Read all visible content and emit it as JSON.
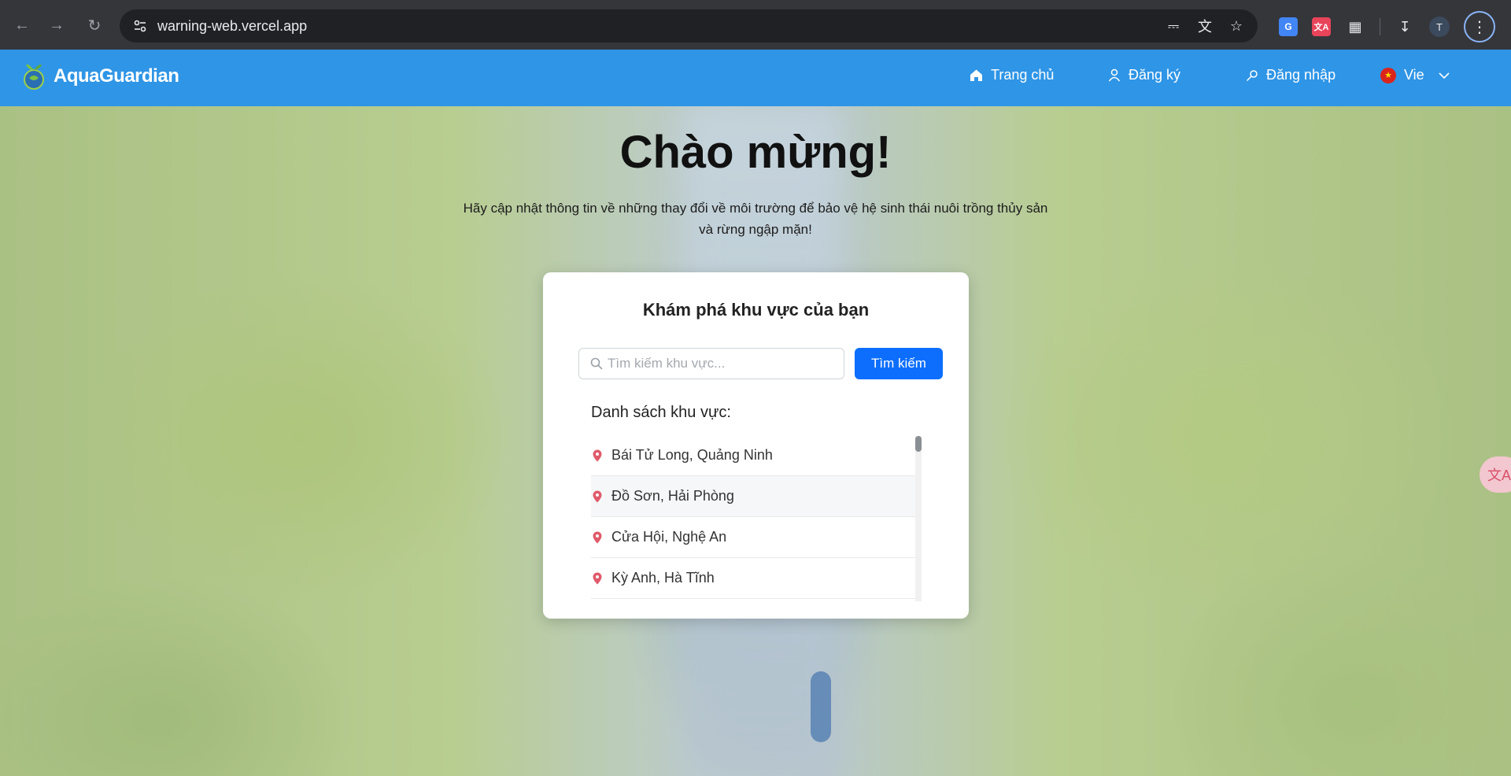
{
  "browser": {
    "url": "warning-web.vercel.app",
    "avatar_letter": "T"
  },
  "site": {
    "brand": "AquaGuardian",
    "nav": {
      "home": "Trang chủ",
      "register": "Đăng ký",
      "login": "Đăng nhập",
      "language": "Vie"
    }
  },
  "hero": {
    "title": "Chào mừng!",
    "subtitle": "Hãy cập nhật thông tin về những thay đổi về môi trường để bảo vệ hệ sinh thái nuôi trồng thủy sản và rừng ngập mặn!"
  },
  "card": {
    "title": "Khám phá khu vực của bạn",
    "search_placeholder": "Tìm kiếm khu vực...",
    "search_button": "Tìm kiếm",
    "list_heading": "Danh sách khu vực:",
    "areas": [
      "Bái Tử Long, Quảng Ninh",
      "Đồ Sơn, Hải Phòng",
      "Cửa Hội, Nghệ An",
      "Kỳ Anh, Hà Tĩnh"
    ]
  },
  "colors": {
    "nav_bg": "#2f95e6",
    "primary_button": "#0d6efd",
    "pin": "#e05a6a"
  }
}
